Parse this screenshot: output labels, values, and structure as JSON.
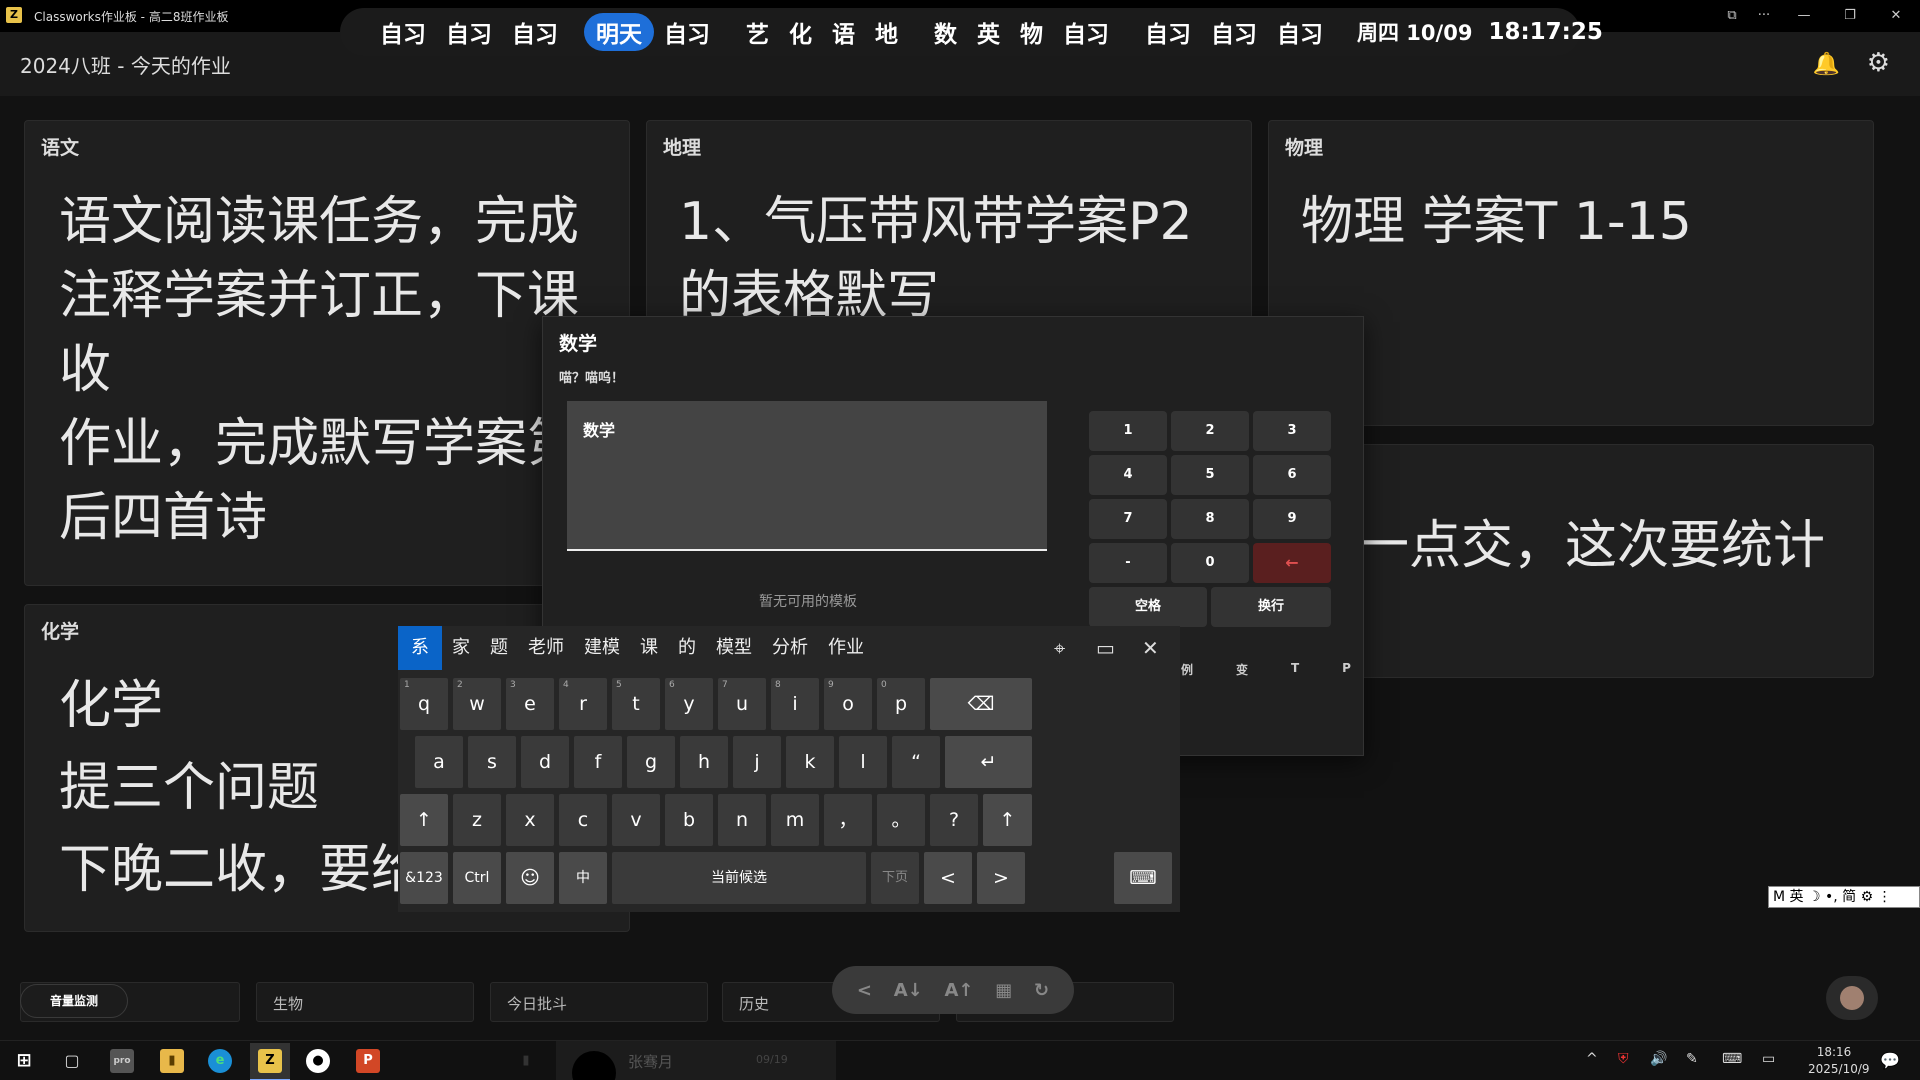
{
  "window": {
    "title": "Classworks作业板 - 高二8班作业板",
    "icon_label": "Z",
    "controls": [
      "⧉",
      "···",
      "—",
      "❐",
      "✕"
    ]
  },
  "schedule": {
    "groups": [
      [
        "自习",
        "自习",
        "自习"
      ],
      [
        "明天",
        "自习"
      ],
      [
        "艺",
        "化",
        "语",
        "地"
      ],
      [
        "数",
        "英",
        "物",
        "自习"
      ],
      [
        "自习",
        "自习",
        "自习"
      ]
    ],
    "active_label": "明天",
    "date": "周四 10/09",
    "time": "18:17:25"
  },
  "header": {
    "title": "2024八班 - 今天的作业"
  },
  "cards": {
    "chinese": {
      "subject": "语文",
      "lines": [
        "语文阅读课任务，完成",
        "注释学案并订正，下课",
        "收",
        "作业，完成默写学案第",
        "后四首诗"
      ]
    },
    "geography": {
      "subject": "地理",
      "lines": [
        "1、气压带风带学案P2",
        "的表格默写"
      ]
    },
    "physics": {
      "subject": "物理",
      "lines": [
        "物理 学案T 1-15"
      ]
    },
    "english": {
      "subject": "",
      "lines": [
        "一点交，这次要统计"
      ]
    },
    "chemistry": {
      "subject": "化学",
      "lines": [
        "化学",
        "提三个问题",
        "下晚二收，要给"
      ]
    }
  },
  "dialog": {
    "title": "数学",
    "subtitle": "喵？喵呜！",
    "textarea_value": "数学",
    "no_template": "暂无可用的模板",
    "numpad": [
      "1",
      "2",
      "3",
      "4",
      "5",
      "6",
      "7",
      "8",
      "9",
      "-",
      "0",
      "←"
    ],
    "space": "空格",
    "newline": "换行",
    "template_letters": [
      "例",
      "变",
      "T",
      "P"
    ]
  },
  "keyboard": {
    "candidates": [
      "系",
      "家",
      "题",
      "老师",
      "建模",
      "课",
      "的",
      "模型",
      "分析",
      "作业"
    ],
    "tools": [
      "⌖",
      "▭",
      "✕"
    ],
    "row1": [
      [
        "q",
        "1"
      ],
      [
        "w",
        "2"
      ],
      [
        "e",
        "3"
      ],
      [
        "r",
        "4"
      ],
      [
        "t",
        "5"
      ],
      [
        "y",
        "6"
      ],
      [
        "u",
        "7"
      ],
      [
        "i",
        "8"
      ],
      [
        "o",
        "9"
      ],
      [
        "p",
        "0"
      ]
    ],
    "row2": [
      "a",
      "s",
      "d",
      "f",
      "g",
      "h",
      "j",
      "k",
      "l",
      "“"
    ],
    "row3": [
      "z",
      "x",
      "c",
      "v",
      "b",
      "n",
      "m",
      "，",
      "。",
      "?"
    ],
    "backspace": "⌫",
    "enter": "↵",
    "shift": "↑",
    "symbols": "&123",
    "ctrl": "Ctrl",
    "emoji": "☺",
    "lang": "中",
    "space_label": "当前候选",
    "next_page": "下页",
    "left": "<",
    "right": ">",
    "kb_icon": "⌨"
  },
  "bottom": {
    "volume_chip": "音量监测",
    "inputs": [
      "生物",
      "今日批斗",
      "历史",
      ""
    ],
    "toolbar": [
      "<",
      "A↓",
      "A↑",
      "▦",
      "↻"
    ]
  },
  "ime": {
    "status": "M 英 ☽ •, 简 ⚙ ⋮"
  },
  "taskbar": {
    "preview_name": "张骞月",
    "preview_date": "09/19",
    "clock_time": "18:16",
    "clock_date": "2025/10/9",
    "tray_icons": [
      "^",
      "⛨",
      "🔊",
      "✎",
      "⌨",
      "▭"
    ],
    "notif": "💬"
  },
  "colors": {
    "accent": "#1e6fd9",
    "candidate_selected": "#0a64c8",
    "backspace_red": "#e05050"
  }
}
